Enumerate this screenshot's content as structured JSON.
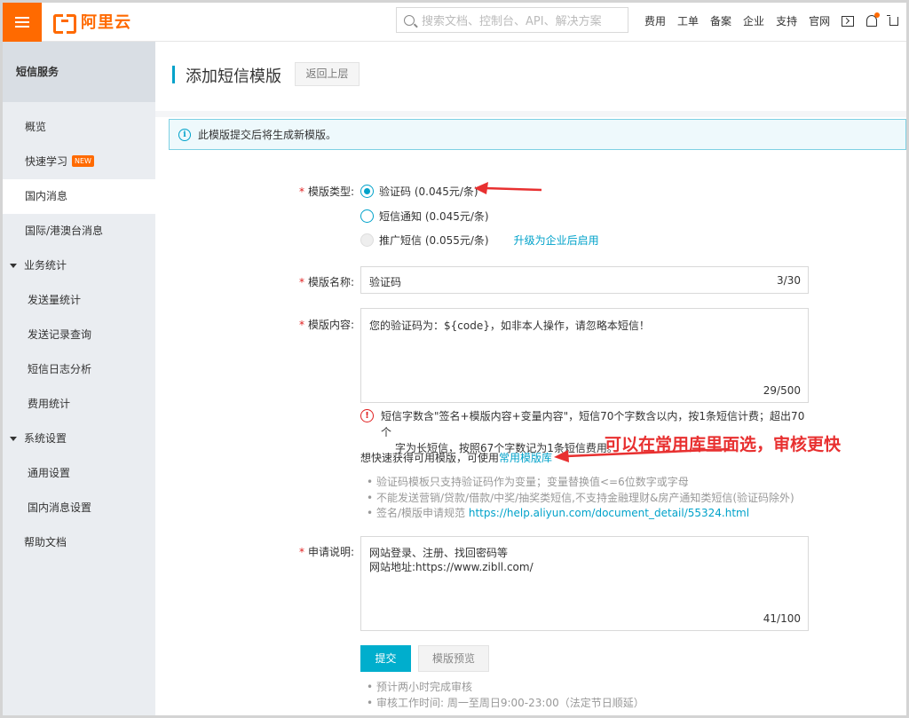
{
  "topbar": {
    "logo": "阿里云",
    "search_placeholder": "搜索文档、控制台、API、解决方案",
    "links": [
      "费用",
      "工单",
      "备案",
      "企业",
      "支持",
      "官网"
    ]
  },
  "sidebar": {
    "title": "短信服务",
    "items": {
      "overview": "概览",
      "quick_learn": "快速学习",
      "new_badge": "NEW",
      "domestic": "国内消息",
      "intl": "国际/港澳台消息",
      "stats_group": "业务统计",
      "send_stats": "发送量统计",
      "send_records": "发送记录查询",
      "log_analysis": "短信日志分析",
      "cost_stats": "费用统计",
      "settings_group": "系统设置",
      "general_settings": "通用设置",
      "domestic_settings": "国内消息设置",
      "help": "帮助文档"
    }
  },
  "page": {
    "title": "添加短信模版",
    "back_button": "返回上层",
    "info_text": "此模版提交后将生成新模版。"
  },
  "form": {
    "type_label": "模版类型:",
    "type_options": {
      "verification": "验证码 (0.045元/条)",
      "notification": "短信通知 (0.045元/条)",
      "promotion": "推广短信 (0.055元/条)"
    },
    "upgrade_link": "升级为企业后启用",
    "name_label": "模版名称:",
    "name_value": "验证码",
    "name_count": "3/30",
    "content_label": "模版内容:",
    "content_value": "您的验证码为：${code}，如非本人操作，请忽略本短信！",
    "content_count": "29/500",
    "warn_line1": "短信字数含\"签名+模版内容+变量内容\"，短信70个字数含以内，按1条短信计费；超出70个",
    "warn_line2": "字为长短信，按照67个字数记为1条短信费用。",
    "quick_text": "想快速获得可用模版，可使用",
    "quick_link": "常用模版库",
    "rules": {
      "r1": "验证码模板只支持验证码作为变量；变量替换值<=6位数字或字母",
      "r2": "不能发送营销/贷款/借款/中奖/抽奖类短信,不支持金融理财&房产通知类短信(验证码除外)",
      "r3_prefix": "签名/模版申请规范 ",
      "r3_link": "https://help.aliyun.com/document_detail/55324.html"
    },
    "reason_label": "申请说明:",
    "reason_line1": "网站登录、注册、找回密码等",
    "reason_line2": "网站地址:https://www.zibll.com/",
    "reason_count": "41/100",
    "submit_button": "提交",
    "preview_button": "模版预览",
    "footer_notes": {
      "n1": "预计两小时完成审核",
      "n2": "审核工作时间: 周一至周日9:00-23:00（法定节日顺延）"
    }
  },
  "annotation": {
    "text": "可以在常用库里面选，审核更快",
    "color": "#e83030"
  },
  "colors": {
    "brand": "#ff6a00",
    "accent": "#00a2ca"
  }
}
